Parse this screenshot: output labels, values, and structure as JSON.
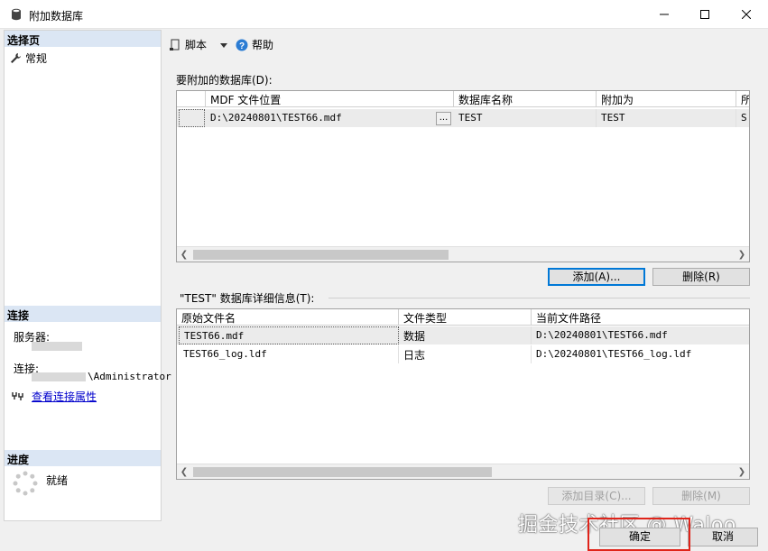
{
  "window": {
    "title": "附加数据库"
  },
  "left": {
    "select_page_header": "选择页",
    "nav_items": [
      {
        "label": "常规"
      }
    ],
    "connection_header": "连接",
    "server_label": "服务器:",
    "connection_label": "连接:",
    "connection_user_suffix": "\\Administrator",
    "view_connection_link": "查看连接属性",
    "progress_header": "进度",
    "progress_status": "就绪"
  },
  "toolbar": {
    "script_label": "脚本",
    "help_label": "帮助"
  },
  "attach_grid": {
    "label": "要附加的数据库(D):",
    "columns": [
      "MDF 文件位置",
      "数据库名称",
      "附加为",
      "所"
    ],
    "rows": [
      {
        "mdf": "D:\\20240801\\TEST66.mdf",
        "db_name": "TEST",
        "attach_as": "TEST",
        "owner": "S"
      }
    ],
    "browse_label": "..."
  },
  "buttons": {
    "add": "添加(A)...",
    "remove": "删除(R)",
    "add_catalog": "添加目录(C)...",
    "remove_detail": "删除(M)",
    "ok": "确定",
    "cancel": "取消"
  },
  "detail_grid": {
    "label": "\"TEST\" 数据库详细信息(T):",
    "columns": [
      "原始文件名",
      "文件类型",
      "当前文件路径"
    ],
    "rows": [
      {
        "name": "TEST66.mdf",
        "type": "数据",
        "path": "D:\\20240801\\TEST66.mdf"
      },
      {
        "name": "TEST66_log.ldf",
        "type": "日志",
        "path": "D:\\20240801\\TEST66_log.ldf"
      }
    ]
  },
  "watermark": "掘金技术社区 @ Waloo",
  "icons": [
    "database-icon",
    "wrench-icon",
    "script-icon",
    "dropdown-icon",
    "help-icon",
    "connection-icon",
    "spinner-icon"
  ],
  "colors": {
    "section_header": "#dbe6f4",
    "link": "#0000cc",
    "focus": "#0078d7",
    "highlight": "#e0241a"
  }
}
